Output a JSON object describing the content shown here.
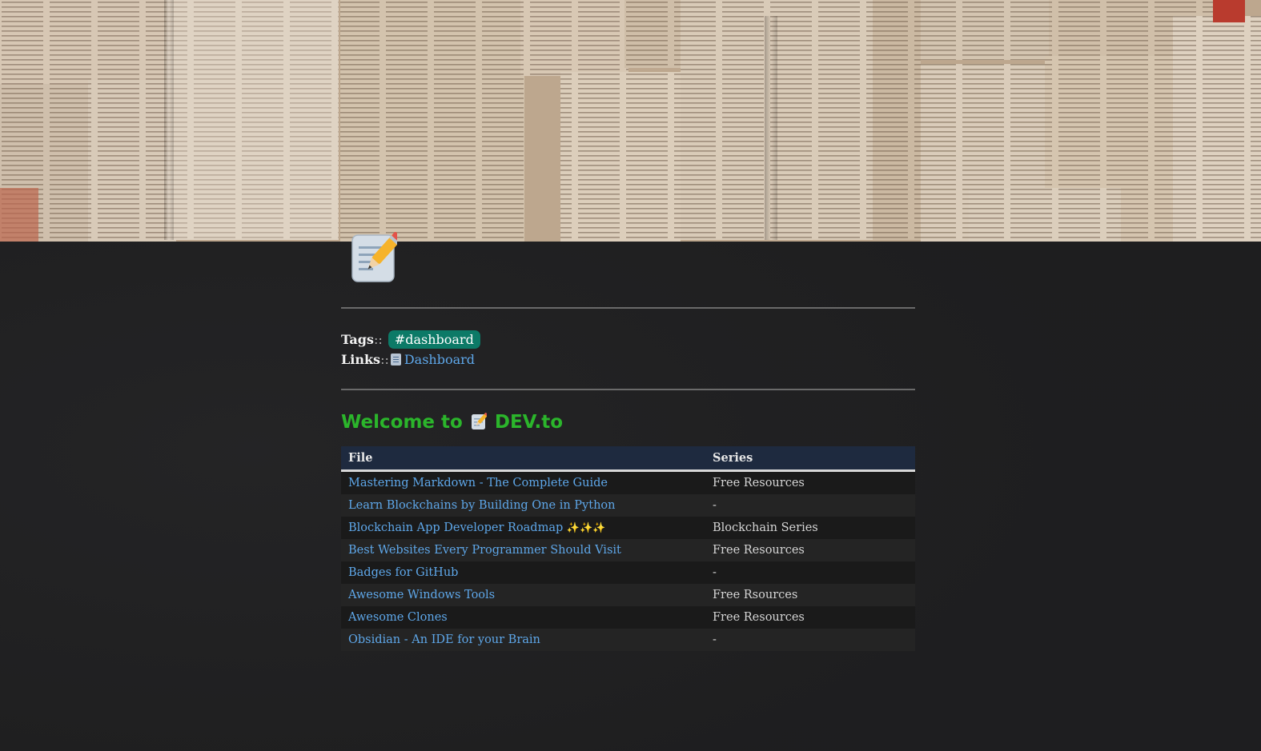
{
  "banner": {
    "icon": "memo-icon"
  },
  "meta": {
    "tags_label": "Tags",
    "tags_sep": "::",
    "tag": "#dashboard",
    "links_label": "Links",
    "links_sep": "::",
    "link_text": "Dashboard",
    "link_icon": "document-icon"
  },
  "heading": {
    "prefix": "Welcome to",
    "icon": "memo-icon",
    "suffix": "DEV.to"
  },
  "table": {
    "headers": [
      "File",
      "Series"
    ],
    "rows": [
      {
        "file": "Mastering Markdown - The Complete Guide",
        "series": "Free Resources"
      },
      {
        "file": "Learn Blockchains by Building One in Python",
        "series": "-"
      },
      {
        "file": "Blockchain App Developer Roadmap",
        "file_suffix": "✨✨✨",
        "series": "Blockchain Series"
      },
      {
        "file": "Best Websites Every Programmer Should Visit",
        "series": "Free Resources"
      },
      {
        "file": "Badges for GitHub",
        "series": "-"
      },
      {
        "file": "Awesome Windows Tools",
        "series": "Free Rsources"
      },
      {
        "file": "Awesome Clones",
        "series": "Free Resources"
      },
      {
        "file": "Obsidian - An IDE for your Brain",
        "series": "-"
      }
    ]
  },
  "colors": {
    "accent_green": "#2bb52b",
    "link_blue": "#5ea7e9",
    "tag_bg": "#0c7a67",
    "table_header_bg": "#1e2a3f"
  }
}
